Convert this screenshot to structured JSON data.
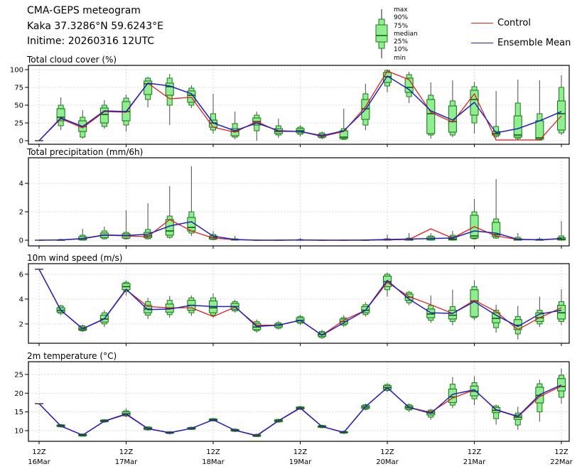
{
  "header": {
    "title": "CMA-GEPS meteogram",
    "station": "Kaka 37.3286°N 59.6243°E",
    "inittime": "Initime: 20260316 12UTC"
  },
  "legend": {
    "box_labels": [
      "max",
      "90%",
      "75%",
      "median",
      "25%",
      "10%",
      "min"
    ],
    "control_label": "Control",
    "mean_label": "Ensemble Mean"
  },
  "colors": {
    "box_fill": "#90ee90",
    "box_edge": "#1e7a1e",
    "median": "#0c5c0c",
    "whisker": "#595959",
    "cap": "#333333",
    "control": "#e01f1f",
    "mean": "#2222bb",
    "grid": "#cccccc",
    "frame": "#000000"
  },
  "xaxis": {
    "ticks": [
      {
        "hour": "12Z",
        "day": "16Mar"
      },
      {
        "hour": "12Z",
        "day": "17Mar"
      },
      {
        "hour": "12Z",
        "day": "18Mar"
      },
      {
        "hour": "12Z",
        "day": "19Mar"
      },
      {
        "hour": "12Z",
        "day": "20Mar"
      },
      {
        "hour": "12Z",
        "day": "21Mar"
      },
      {
        "hour": "12Z",
        "day": "22Mar"
      }
    ],
    "step_hours": 6
  },
  "chart_data": [
    {
      "type": "boxplot",
      "title": "Total cloud cover (%)",
      "ylim": [
        -5,
        106
      ],
      "yticks": [
        0,
        25,
        50,
        75,
        100
      ],
      "box_stats_order": [
        "min",
        "p10",
        "p25",
        "median",
        "p75",
        "p90",
        "max"
      ],
      "boxes": [
        [
          0,
          0,
          0,
          0,
          0,
          0,
          0
        ],
        [
          15,
          21,
          28,
          33,
          45,
          50,
          61
        ],
        [
          3,
          5,
          13,
          20,
          28,
          33,
          43
        ],
        [
          17,
          20,
          25,
          37,
          46,
          50,
          57
        ],
        [
          13,
          22,
          28,
          41,
          55,
          60,
          65
        ],
        [
          47,
          58,
          65,
          80,
          84,
          88,
          90
        ],
        [
          22,
          50,
          64,
          76,
          81,
          88,
          94
        ],
        [
          46,
          50,
          54,
          64,
          70,
          74,
          78
        ],
        [
          10,
          15,
          19,
          25,
          29,
          38,
          66
        ],
        [
          2,
          5,
          7,
          13,
          17,
          24,
          41
        ],
        [
          0,
          14,
          22,
          27,
          32,
          36,
          41
        ],
        [
          4,
          8,
          10,
          13,
          17,
          21,
          31
        ],
        [
          6,
          9,
          11,
          14,
          17,
          19,
          22
        ],
        [
          2,
          4,
          5,
          7,
          9,
          11,
          13
        ],
        [
          1,
          2,
          3,
          5,
          14,
          17,
          45
        ],
        [
          15,
          22,
          30,
          45,
          58,
          66,
          80
        ],
        [
          68,
          77,
          82,
          90,
          96,
          99,
          100
        ],
        [
          53,
          62,
          68,
          75,
          88,
          93,
          97
        ],
        [
          3,
          8,
          10,
          38,
          58,
          64,
          82
        ],
        [
          5,
          8,
          12,
          27,
          49,
          56,
          85
        ],
        [
          10,
          25,
          36,
          58,
          71,
          76,
          83
        ],
        [
          4,
          6,
          8,
          10,
          13,
          20,
          70
        ],
        [
          1,
          3,
          5,
          8,
          35,
          53,
          86
        ],
        [
          0,
          1,
          2,
          4,
          28,
          38,
          85
        ],
        [
          8,
          11,
          15,
          38,
          56,
          75,
          92
        ]
      ],
      "series": [
        {
          "name": "Control",
          "values": [
            0,
            31,
            18,
            41,
            40,
            81,
            59,
            61,
            19,
            12,
            27,
            13,
            13,
            6,
            13,
            48,
            98,
            86,
            40,
            26,
            66,
            1,
            1,
            1,
            35
          ]
        },
        {
          "name": "Ensemble Mean",
          "values": [
            0,
            32,
            20,
            42,
            41,
            81,
            77,
            66,
            25,
            14,
            25,
            14,
            13,
            7,
            14,
            44,
            91,
            72,
            42,
            29,
            54,
            11,
            17,
            28,
            41
          ]
        }
      ]
    },
    {
      "type": "boxplot",
      "title": "Total precipitation (mm/6h)",
      "ylim": [
        -0.4,
        5.8
      ],
      "yticks": [
        0,
        2,
        4
      ],
      "box_stats_order": [
        "min",
        "p10",
        "p25",
        "median",
        "p75",
        "p90",
        "max"
      ],
      "boxes": [
        [
          0,
          0,
          0,
          0,
          0,
          0,
          0
        ],
        [
          0,
          0,
          0,
          0,
          0.02,
          0.05,
          0.1
        ],
        [
          0,
          0,
          0.02,
          0.1,
          0.25,
          0.35,
          0.8
        ],
        [
          0.05,
          0.1,
          0.18,
          0.35,
          0.5,
          0.65,
          0.95
        ],
        [
          0.05,
          0.1,
          0.15,
          0.3,
          0.45,
          0.55,
          2.1
        ],
        [
          0.05,
          0.1,
          0.18,
          0.3,
          0.55,
          0.75,
          2.6
        ],
        [
          0.1,
          0.2,
          0.35,
          0.65,
          1.45,
          1.7,
          3.8
        ],
        [
          0.3,
          0.5,
          0.65,
          0.9,
          1.6,
          2.0,
          5.2
        ],
        [
          0,
          0.05,
          0.08,
          0.18,
          0.3,
          0.4,
          0.65
        ],
        [
          0,
          0,
          0.01,
          0.03,
          0.06,
          0.1,
          0.3
        ],
        [
          0,
          0,
          0,
          0,
          0,
          0,
          0
        ],
        [
          0,
          0,
          0,
          0,
          0,
          0,
          0
        ],
        [
          0,
          0,
          0,
          0.01,
          0.02,
          0.05,
          0.15
        ],
        [
          0,
          0,
          0,
          0,
          0,
          0,
          0
        ],
        [
          0,
          0,
          0,
          0,
          0,
          0,
          0
        ],
        [
          0,
          0,
          0,
          0,
          0,
          0,
          0.05
        ],
        [
          0,
          0,
          0,
          0.02,
          0.06,
          0.1,
          0.4
        ],
        [
          0,
          0,
          0,
          0.02,
          0.08,
          0.15,
          0.5
        ],
        [
          0,
          0,
          0.02,
          0.1,
          0.22,
          0.3,
          0.5
        ],
        [
          0,
          0,
          0.02,
          0.08,
          0.25,
          0.35,
          0.65
        ],
        [
          0.05,
          0.1,
          0.15,
          0.3,
          1.75,
          2.0,
          2.9
        ],
        [
          0.1,
          0.15,
          0.25,
          0.4,
          1.25,
          1.5,
          4.3
        ],
        [
          0,
          0,
          0,
          0.03,
          0.1,
          0.2,
          0.5
        ],
        [
          0,
          0,
          0,
          0.01,
          0.03,
          0.08,
          0.2
        ],
        [
          0,
          0,
          0.02,
          0.08,
          0.18,
          0.3,
          1.35
        ]
      ],
      "series": [
        {
          "name": "Control",
          "values": [
            0,
            0.02,
            0.1,
            0.35,
            0.3,
            0.25,
            1.45,
            0.65,
            0.15,
            0.04,
            0,
            0,
            0.01,
            0,
            0,
            0,
            0.02,
            0.05,
            0.8,
            0.15,
            0.95,
            0.3,
            0.05,
            0.02,
            0.1
          ]
        },
        {
          "name": "Ensemble Mean",
          "values": [
            0,
            0.02,
            0.12,
            0.37,
            0.33,
            0.42,
            1.0,
            1.3,
            0.28,
            0.05,
            0,
            0,
            0.02,
            0,
            0,
            0.01,
            0.05,
            0.08,
            0.12,
            0.15,
            0.65,
            0.5,
            0.06,
            0.03,
            0.12
          ]
        }
      ]
    },
    {
      "type": "boxplot",
      "title": "10m wind speed (m/s)",
      "ylim": [
        0.45,
        6.85
      ],
      "yticks": [
        2,
        4,
        6
      ],
      "box_stats_order": [
        "min",
        "p10",
        "p25",
        "median",
        "p75",
        "p90",
        "max"
      ],
      "boxes": [
        [
          6.4,
          6.4,
          6.4,
          6.4,
          6.4,
          6.4,
          6.4
        ],
        [
          2.7,
          2.85,
          2.95,
          3.1,
          3.3,
          3.45,
          3.55
        ],
        [
          1.35,
          1.45,
          1.5,
          1.6,
          1.75,
          1.85,
          1.95
        ],
        [
          1.75,
          2.0,
          2.15,
          2.4,
          2.7,
          2.9,
          3.1
        ],
        [
          4.3,
          4.6,
          4.75,
          5.0,
          5.25,
          5.35,
          5.5
        ],
        [
          2.4,
          2.7,
          2.9,
          3.2,
          3.5,
          3.8,
          4.1
        ],
        [
          2.5,
          2.75,
          2.95,
          3.25,
          3.6,
          3.9,
          4.25
        ],
        [
          2.65,
          2.9,
          3.1,
          3.5,
          3.9,
          4.1,
          4.3
        ],
        [
          2.5,
          2.7,
          2.9,
          3.3,
          3.85,
          4.1,
          4.45
        ],
        [
          2.9,
          3.05,
          3.15,
          3.4,
          3.65,
          3.8,
          3.95
        ],
        [
          1.3,
          1.45,
          1.55,
          1.75,
          2.05,
          2.2,
          2.35
        ],
        [
          1.55,
          1.65,
          1.75,
          1.9,
          2.0,
          2.1,
          2.25
        ],
        [
          1.9,
          2.05,
          2.15,
          2.3,
          2.5,
          2.6,
          2.75
        ],
        [
          0.8,
          0.9,
          1.0,
          1.15,
          1.3,
          1.4,
          1.55
        ],
        [
          1.75,
          1.9,
          2.0,
          2.2,
          2.4,
          2.5,
          2.7
        ],
        [
          2.6,
          2.75,
          2.9,
          3.1,
          3.4,
          3.55,
          3.75
        ],
        [
          4.2,
          4.75,
          5.0,
          5.4,
          5.85,
          6.0,
          6.15
        ],
        [
          3.5,
          3.7,
          3.9,
          4.15,
          4.4,
          4.55,
          4.65
        ],
        [
          2.1,
          2.3,
          2.5,
          2.8,
          3.2,
          3.5,
          4.3
        ],
        [
          1.9,
          2.2,
          2.4,
          2.7,
          3.1,
          3.4,
          4.75
        ],
        [
          2.3,
          2.5,
          2.6,
          3.85,
          4.75,
          5.0,
          5.5
        ],
        [
          1.3,
          1.7,
          2.1,
          2.45,
          2.9,
          3.1,
          3.55
        ],
        [
          0.75,
          1.2,
          1.55,
          1.9,
          2.35,
          2.6,
          3.45
        ],
        [
          1.75,
          2.0,
          2.2,
          2.5,
          2.9,
          3.1,
          4.2
        ],
        [
          1.9,
          2.2,
          2.4,
          2.9,
          3.5,
          3.8,
          4.8
        ]
      ],
      "series": [
        {
          "name": "Control",
          "values": [
            6.4,
            3.1,
            1.6,
            2.4,
            4.75,
            3.4,
            3.3,
            3.3,
            2.6,
            3.35,
            1.9,
            1.9,
            2.3,
            1.1,
            2.3,
            3.1,
            5.35,
            4.2,
            3.55,
            2.85,
            3.9,
            3.0,
            1.55,
            2.5,
            3.3
          ]
        },
        {
          "name": "Ensemble Mean",
          "values": [
            6.4,
            3.1,
            1.62,
            2.42,
            4.8,
            3.15,
            3.2,
            3.5,
            3.4,
            3.4,
            1.8,
            1.9,
            2.3,
            1.1,
            2.1,
            3.1,
            5.5,
            4.0,
            2.9,
            2.85,
            3.8,
            2.7,
            1.8,
            2.8,
            3.1
          ]
        }
      ]
    },
    {
      "type": "boxplot",
      "title": "2m temperature (°C)",
      "ylim": [
        7.15,
        28.4
      ],
      "yticks": [
        10,
        15,
        20,
        25
      ],
      "box_stats_order": [
        "min",
        "p10",
        "p25",
        "median",
        "p75",
        "p90",
        "max"
      ],
      "boxes": [
        [
          17.2,
          17.2,
          17.2,
          17.2,
          17.2,
          17.2,
          17.2
        ],
        [
          10.8,
          11.0,
          11.1,
          11.3,
          11.5,
          11.6,
          11.8
        ],
        [
          8.4,
          8.5,
          8.6,
          8.8,
          9.0,
          9.1,
          9.2
        ],
        [
          12.1,
          12.3,
          12.4,
          12.6,
          12.8,
          12.9,
          13.1
        ],
        [
          13.6,
          13.9,
          14.1,
          14.5,
          15.0,
          15.3,
          15.9
        ],
        [
          10.0,
          10.2,
          10.3,
          10.6,
          10.9,
          11.0,
          11.2
        ],
        [
          9.0,
          9.2,
          9.3,
          9.45,
          9.6,
          9.7,
          9.9
        ],
        [
          10.2,
          10.3,
          10.4,
          10.6,
          10.8,
          10.9,
          11.1
        ],
        [
          12.4,
          12.6,
          12.7,
          12.9,
          13.1,
          13.2,
          13.4
        ],
        [
          9.6,
          9.8,
          9.9,
          10.1,
          10.3,
          10.4,
          10.6
        ],
        [
          8.3,
          8.4,
          8.5,
          8.7,
          8.9,
          9.0,
          9.2
        ],
        [
          12.1,
          12.3,
          12.4,
          12.65,
          12.9,
          13.0,
          13.2
        ],
        [
          15.5,
          15.7,
          15.8,
          16.05,
          16.3,
          16.4,
          16.6
        ],
        [
          10.6,
          10.8,
          10.9,
          11.1,
          11.3,
          11.4,
          11.6
        ],
        [
          9.1,
          9.3,
          9.4,
          9.55,
          9.7,
          9.8,
          10.0
        ],
        [
          15.4,
          15.7,
          15.9,
          16.3,
          16.7,
          16.9,
          17.2
        ],
        [
          20.3,
          20.7,
          21.0,
          21.5,
          22.0,
          22.3,
          22.7
        ],
        [
          15.0,
          15.5,
          15.8,
          16.2,
          16.6,
          16.9,
          17.3
        ],
        [
          12.9,
          13.6,
          14.2,
          14.7,
          15.2,
          15.5,
          15.8
        ],
        [
          16.0,
          16.8,
          17.5,
          19.0,
          21.1,
          22.4,
          24.3
        ],
        [
          16.8,
          18.5,
          19.3,
          20.5,
          21.9,
          22.8,
          24.5
        ],
        [
          11.6,
          13.2,
          14.8,
          15.4,
          16.2,
          16.6,
          16.9
        ],
        [
          10.2,
          11.5,
          13.0,
          13.6,
          14.2,
          14.7,
          16.4
        ],
        [
          12.4,
          15.0,
          17.4,
          19.4,
          21.6,
          22.5,
          23.6
        ],
        [
          17.2,
          18.9,
          20.6,
          21.8,
          23.9,
          24.8,
          26.6
        ]
      ],
      "series": [
        {
          "name": "Control",
          "values": [
            17.2,
            11.2,
            8.8,
            12.5,
            14.3,
            10.5,
            9.4,
            10.6,
            12.9,
            10.1,
            8.6,
            12.6,
            16.0,
            11.1,
            9.5,
            16.4,
            21.5,
            16.2,
            14.9,
            18.7,
            20.9,
            15.5,
            13.7,
            19.1,
            21.9
          ]
        },
        {
          "name": "Ensemble Mean",
          "values": [
            17.2,
            11.25,
            8.8,
            12.55,
            14.45,
            10.55,
            9.45,
            10.6,
            12.9,
            10.1,
            8.7,
            12.65,
            16.1,
            11.1,
            9.55,
            16.4,
            21.5,
            16.2,
            14.6,
            19.7,
            20.9,
            15.6,
            13.8,
            19.6,
            22.2
          ]
        }
      ]
    }
  ]
}
